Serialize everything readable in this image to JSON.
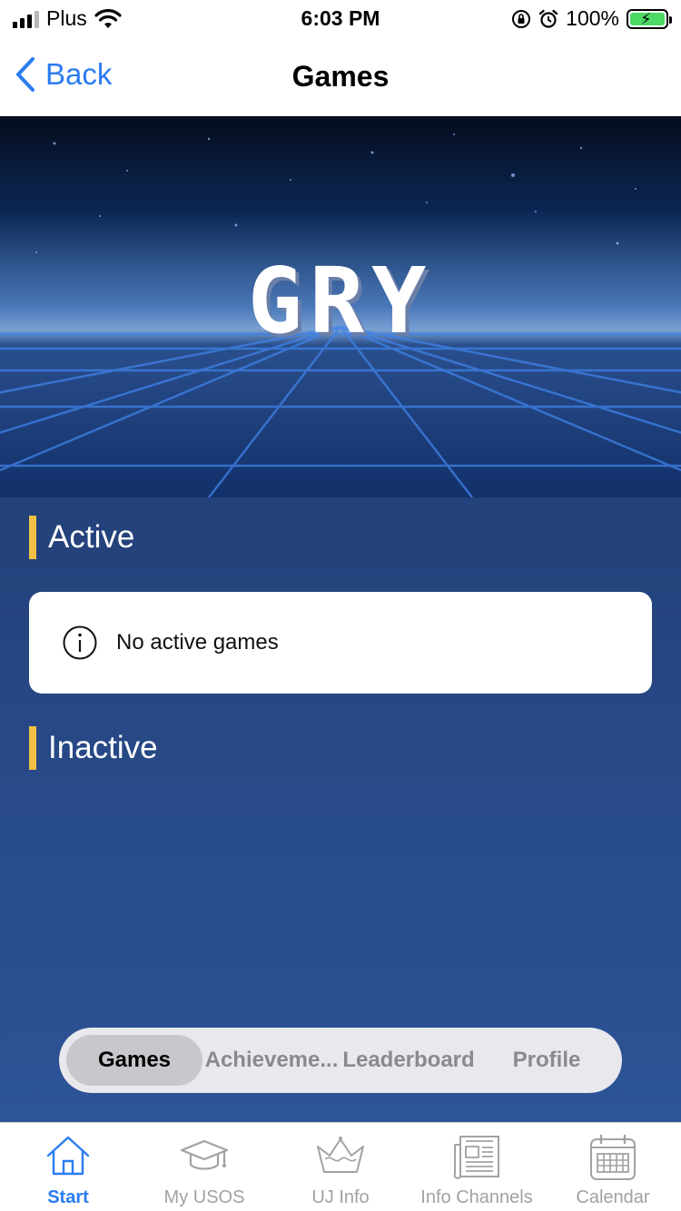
{
  "status_bar": {
    "carrier": "Plus",
    "time": "6:03 PM",
    "battery": "100%",
    "signal_bars": 4,
    "signal_bars_active": 3,
    "icons": [
      "signal-icon",
      "wifi-icon",
      "orientation-lock-icon",
      "alarm-icon",
      "battery-charging-icon"
    ]
  },
  "nav": {
    "back_label": "Back",
    "title": "Games"
  },
  "hero": {
    "logo_text": "GRY"
  },
  "sections": {
    "active": {
      "title": "Active",
      "empty_message": "No active games"
    },
    "inactive": {
      "title": "Inactive"
    }
  },
  "segments": {
    "items": [
      "Games",
      "Achieveme...",
      "Leaderboard",
      "Profile"
    ],
    "selected": "Games"
  },
  "tab_bar": {
    "items": [
      {
        "label": "Start",
        "icon": "home-icon"
      },
      {
        "label": "My USOS",
        "icon": "graduation-cap-icon"
      },
      {
        "label": "UJ Info",
        "icon": "crown-icon"
      },
      {
        "label": "Info Channels",
        "icon": "newspaper-icon"
      },
      {
        "label": "Calendar",
        "icon": "calendar-icon"
      }
    ],
    "selected": "Start"
  },
  "colors": {
    "accent": "#2b7cf2",
    "section_bar": "#f2c044",
    "content_bg": "#23417a"
  }
}
